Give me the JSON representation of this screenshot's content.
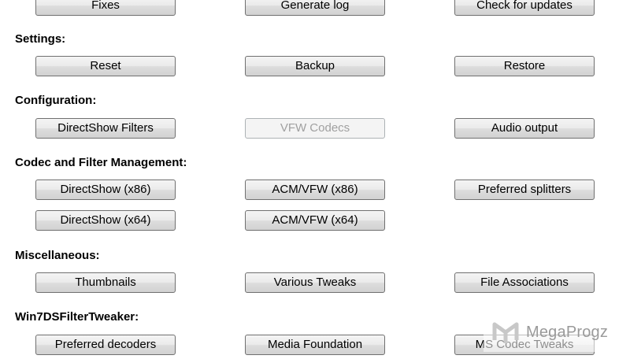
{
  "rows": {
    "top": {
      "fixes": "Fixes",
      "generate_log": "Generate log",
      "check_updates": "Check for updates"
    },
    "settings": {
      "label": "Settings:",
      "reset": "Reset",
      "backup": "Backup",
      "restore": "Restore"
    },
    "configuration": {
      "label": "Configuration:",
      "directshow_filters": "DirectShow Filters",
      "vfw_codecs": "VFW Codecs",
      "audio_output": "Audio output"
    },
    "codec_management": {
      "label": "Codec and Filter Management:",
      "directshow_x86": "DirectShow  (x86)",
      "acm_vfw_x86": "ACM/VFW  (x86)",
      "preferred_splitters": "Preferred splitters",
      "directshow_x64": "DirectShow  (x64)",
      "acm_vfw_x64": "ACM/VFW  (x64)"
    },
    "misc": {
      "label": "Miscellaneous:",
      "thumbnails": "Thumbnails",
      "various_tweaks": "Various Tweaks",
      "file_associations": "File Associations"
    },
    "win7ds": {
      "label": "Win7DSFilterTweaker:",
      "preferred_decoders": "Preferred decoders",
      "media_foundation": "Media Foundation",
      "ms_codec_tweaks": "MS Codec Tweaks"
    }
  },
  "watermark": {
    "text": "MegaProgz"
  },
  "colors": {
    "button_border": "#707070",
    "disabled_text": "#a0a0a0",
    "watermark": "#9a9a9a"
  }
}
